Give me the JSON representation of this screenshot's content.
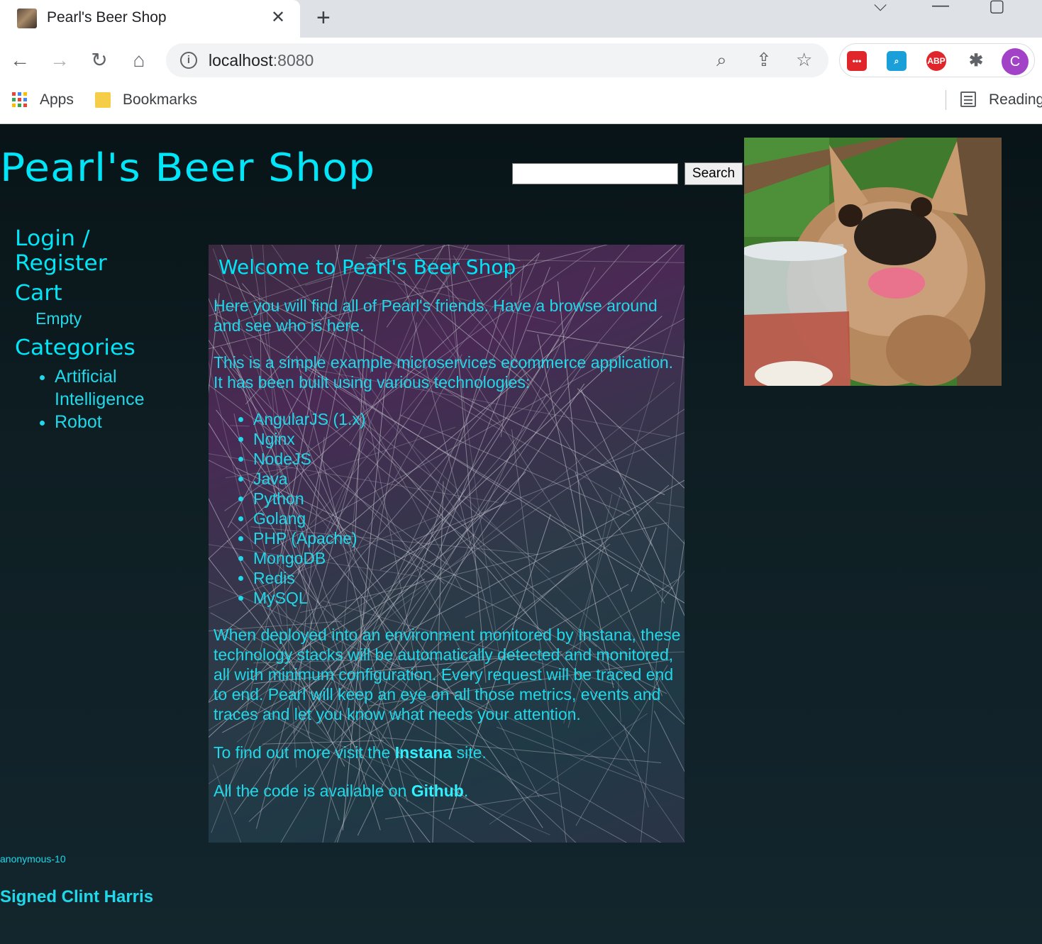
{
  "browser": {
    "tab_title": "Pearl's Beer Shop",
    "tab_close": "✕",
    "new_tab": "+",
    "url_host": "localhost",
    "url_port": ":8080",
    "bookmarks": {
      "apps": "Apps",
      "bookmarks": "Bookmarks",
      "reading": "Reading"
    },
    "avatar_letter": "C",
    "ext_abp": "ABP"
  },
  "site": {
    "title": "Pearl's Beer Shop",
    "search_button": "Search",
    "search_value": ""
  },
  "sidebar": {
    "login_line1": "Login /",
    "login_line2": "Register",
    "cart": "Cart",
    "cart_status": "Empty",
    "categories": "Categories",
    "category_items": [
      "Artificial Intelligence",
      "Robot"
    ]
  },
  "content": {
    "heading": "Welcome to Pearl's Beer Shop",
    "p1": "Here you will find all of Pearl's friends. Have a browse around and see who is here.",
    "p2": "This is a simple example microservices ecommerce application. It has been built using various technologies:",
    "technologies": [
      "AngularJS (1.x)",
      "Nginx",
      "NodeJS",
      "Java",
      "Python",
      "Golang",
      "PHP (Apache)",
      "MongoDB",
      "Redis",
      "MySQL"
    ],
    "p3": "When deployed into an environment monitored by Instana, these technology stacks will be automatically detected and monitored, all with minimum configuration. Every request will be traced end to end. Pearl will keep an eye on all those metrics, events and traces and let you know what needs your attention.",
    "p4_before": "To find out more visit the ",
    "p4_link": "Instana",
    "p4_after": " site.",
    "p5_before": "All the code is available on ",
    "p5_link": "Github",
    "p5_after": "."
  },
  "footer": {
    "user": "anonymous-10",
    "signed": "Signed Clint Harris"
  }
}
